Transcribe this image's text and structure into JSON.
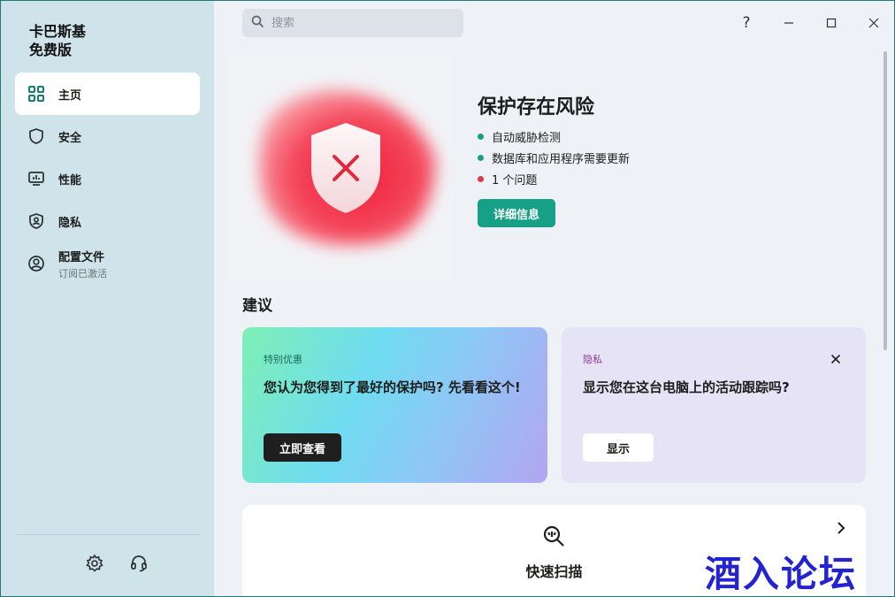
{
  "app": {
    "title_line1": "卡巴斯基",
    "title_line2": "免费版"
  },
  "sidebar": {
    "items": [
      {
        "label": "主页",
        "icon": "dashboard-icon"
      },
      {
        "label": "安全",
        "icon": "shield-icon"
      },
      {
        "label": "性能",
        "icon": "monitor-icon"
      },
      {
        "label": "隐私",
        "icon": "privacy-shield-icon"
      },
      {
        "label": "配置文件",
        "sub": "订阅已激活",
        "icon": "user-icon"
      }
    ],
    "bottom": [
      "gear-icon",
      "headset-icon"
    ]
  },
  "search": {
    "placeholder": "搜索"
  },
  "window_controls": {
    "help": "?"
  },
  "hero": {
    "title": "保护存在风险",
    "items": [
      {
        "text": "自动威胁检测",
        "color": "#16a085"
      },
      {
        "text": "数据库和应用程序需要更新",
        "color": "#16a085"
      },
      {
        "text": "1 个问题",
        "color": "#d93a49"
      }
    ],
    "button": "详细信息"
  },
  "recommendations": {
    "title": "建议",
    "promo": {
      "tag": "特别优惠",
      "text": "您认为您得到了最好的保护吗? 先看看这个!",
      "button": "立即查看"
    },
    "privacy": {
      "tag": "隐私",
      "text": "显示您在这台电脑上的活动跟踪吗?",
      "button": "显示"
    }
  },
  "scan": {
    "label": "快速扫描"
  },
  "watermark": "酒入论坛",
  "colors": {
    "accent": "#16a085",
    "danger": "#e8243a",
    "sidebar": "#cfe3ea"
  }
}
